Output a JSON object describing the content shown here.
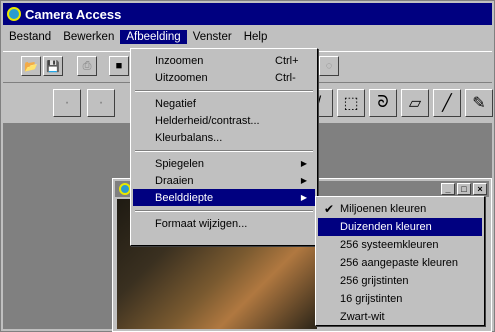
{
  "window": {
    "title": "Camera Access"
  },
  "menubar": {
    "items": [
      {
        "label": "Bestand"
      },
      {
        "label": "Bewerken"
      },
      {
        "label": "Afbeelding"
      },
      {
        "label": "Venster"
      },
      {
        "label": "Help"
      }
    ]
  },
  "afbeelding_menu": {
    "items": [
      {
        "label": "Inzoomen",
        "shortcut": "Ctrl+"
      },
      {
        "label": "Uitzoomen",
        "shortcut": "Ctrl-"
      },
      {
        "label": "Negatief"
      },
      {
        "label": "Helderheid/contrast..."
      },
      {
        "label": "Kleurbalans..."
      },
      {
        "label": "Spiegelen"
      },
      {
        "label": "Draaien"
      },
      {
        "label": "Beelddiepte"
      },
      {
        "label": "Formaat wijzigen..."
      }
    ]
  },
  "beelddiepte_submenu": {
    "items": [
      {
        "label": "Miljoenen kleuren",
        "checked": true
      },
      {
        "label": "Duizenden kleuren"
      },
      {
        "label": "256 systeemkleuren"
      },
      {
        "label": "256 aangepaste kleuren"
      },
      {
        "label": "256 grijstinten"
      },
      {
        "label": "16 grijstinten"
      },
      {
        "label": "Zwart-wit"
      }
    ],
    "check_mark": "✔"
  },
  "colors": {
    "title_active": "#000080",
    "face": "#c0c0c0"
  }
}
